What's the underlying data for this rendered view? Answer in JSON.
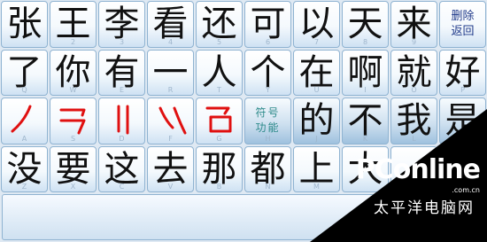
{
  "rows": [
    [
      {
        "type": "char",
        "text": "张",
        "hint": ""
      },
      {
        "type": "char",
        "text": "王",
        "hint": "2"
      },
      {
        "type": "char",
        "text": "李",
        "hint": "3"
      },
      {
        "type": "char",
        "text": "看",
        "hint": "4"
      },
      {
        "type": "char",
        "text": "还",
        "hint": "5"
      },
      {
        "type": "char",
        "text": "可",
        "hint": "6"
      },
      {
        "type": "char",
        "text": "以",
        "hint": "7"
      },
      {
        "type": "char",
        "text": "天",
        "hint": "8"
      },
      {
        "type": "char",
        "text": "来",
        "hint": "9"
      },
      {
        "type": "func",
        "lines": [
          "删除",
          "返回"
        ],
        "hint": ""
      }
    ],
    [
      {
        "type": "char",
        "text": "了",
        "hint": "Q"
      },
      {
        "type": "char",
        "text": "你",
        "hint": "W"
      },
      {
        "type": "char",
        "text": "有",
        "hint": "E"
      },
      {
        "type": "char",
        "text": "一",
        "hint": "R"
      },
      {
        "type": "char",
        "text": "人",
        "hint": "T"
      },
      {
        "type": "char",
        "text": "个",
        "hint": "Y"
      },
      {
        "type": "char",
        "text": "在",
        "hint": "U"
      },
      {
        "type": "char",
        "text": "啊",
        "hint": "I"
      },
      {
        "type": "char",
        "text": "就",
        "hint": "O"
      },
      {
        "type": "char",
        "text": "好",
        "hint": "P"
      }
    ],
    [
      {
        "type": "stroke",
        "stroke": "pie",
        "hint": "A"
      },
      {
        "type": "stroke",
        "stroke": "hengzhe",
        "hint": "S"
      },
      {
        "type": "stroke",
        "stroke": "shu",
        "hint": "D"
      },
      {
        "type": "stroke",
        "stroke": "dian",
        "hint": "F"
      },
      {
        "type": "stroke",
        "stroke": "zhe",
        "hint": "G"
      },
      {
        "type": "symbol",
        "lines": [
          "符号",
          "功能"
        ],
        "hint": "H"
      },
      {
        "type": "char",
        "text": "的",
        "hint": "J"
      },
      {
        "type": "char",
        "text": "不",
        "hint": "K"
      },
      {
        "type": "char",
        "text": "我",
        "hint": "L"
      },
      {
        "type": "char",
        "text": "是",
        "hint": ""
      }
    ],
    [
      {
        "type": "char",
        "text": "没",
        "hint": "Z"
      },
      {
        "type": "char",
        "text": "要",
        "hint": "X"
      },
      {
        "type": "char",
        "text": "这",
        "hint": "C"
      },
      {
        "type": "char",
        "text": "去",
        "hint": "V"
      },
      {
        "type": "char",
        "text": "那",
        "hint": "B"
      },
      {
        "type": "char",
        "text": "都",
        "hint": "N"
      },
      {
        "type": "char",
        "text": "上",
        "hint": "M"
      },
      {
        "type": "char",
        "text": "大",
        "hint": ""
      },
      {
        "type": "char",
        "text": "",
        "hint": ""
      },
      {
        "type": "char",
        "text": "",
        "hint": ""
      }
    ]
  ],
  "colors": {
    "stroke_red": "#e01010",
    "func_navy": "#203a8a",
    "symbol_teal": "#2c8a8a"
  },
  "input_value": "",
  "watermark": {
    "brand": "PConline",
    "domain": ".com.cn",
    "cn": "太平洋电脑网"
  }
}
